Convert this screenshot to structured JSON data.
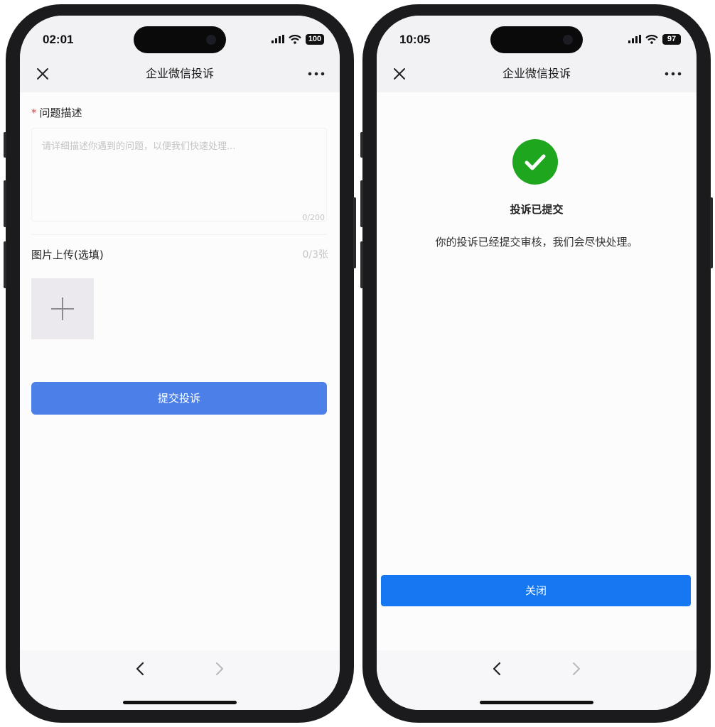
{
  "left_phone": {
    "status": {
      "time": "02:01",
      "battery": "100"
    },
    "nav": {
      "title": "企业微信投诉"
    },
    "form": {
      "required_mark": "*",
      "description_label": "问题描述",
      "description_placeholder": "请详细描述你遇到的问题，以便我们快速处理...",
      "description_counter": "0/200",
      "upload_label": "图片上传(选填)",
      "upload_count": "0/3张",
      "submit_label": "提交投诉"
    }
  },
  "right_phone": {
    "status": {
      "time": "10:05",
      "battery": "97"
    },
    "nav": {
      "title": "企业微信投诉"
    },
    "success": {
      "title": "投诉已提交",
      "description": "你的投诉已经提交审核，我们会尽快处理。",
      "close_label": "关闭"
    }
  },
  "colors": {
    "primary_blue": "#4c7fe7",
    "close_blue": "#1677f2",
    "success_green": "#1ea61e",
    "required_red": "#e5443c"
  },
  "icons": [
    "close-icon",
    "more-icon",
    "signal-icon",
    "wifi-icon",
    "battery-icon",
    "plus-icon",
    "check-icon",
    "back-arrow-icon",
    "forward-arrow-icon"
  ]
}
